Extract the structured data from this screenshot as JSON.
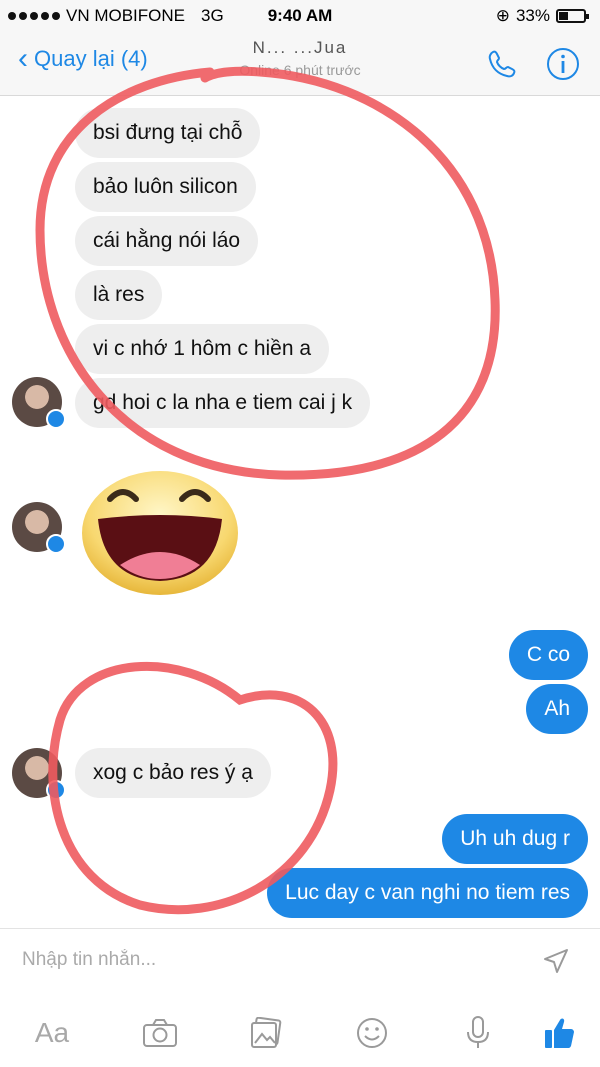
{
  "status_bar": {
    "carrier": "VN MOBIFONE",
    "network": "3G",
    "time": "9:40 AM",
    "battery": "33%",
    "battery_level": 0.33
  },
  "nav": {
    "back_label": "Quay lại (4)",
    "contact_name": "N... ...Jua",
    "contact_status": "Online 6 phút trước",
    "icons": [
      "phone-icon",
      "info-icon"
    ]
  },
  "messages": {
    "incoming_1": [
      "bsi đưng tại chỗ",
      "bảo luôn silicon",
      "cái hằng nói láo",
      "là res",
      "vi c nhớ 1 hôm c hiền a",
      "gd hoi c la nha e tiem cai j k"
    ],
    "sticker": "laughing-face-sticker",
    "outgoing_1": [
      "C co",
      "Ah"
    ],
    "incoming_2": [
      "xog c bảo res ý ạ"
    ],
    "outgoing_2": [
      "Uh uh dug r",
      "Luc day c van nghi no tiem res"
    ]
  },
  "composer": {
    "placeholder": "Nhập tin nhắn...",
    "text_button": "Aa",
    "tools": [
      "camera-icon",
      "gallery-icon",
      "emoji-icon",
      "microphone-icon",
      "like-icon"
    ]
  },
  "colors": {
    "accent": "#1e88e5",
    "incoming_bubble": "#eeeeee",
    "annotation": "#ee5b5f"
  }
}
